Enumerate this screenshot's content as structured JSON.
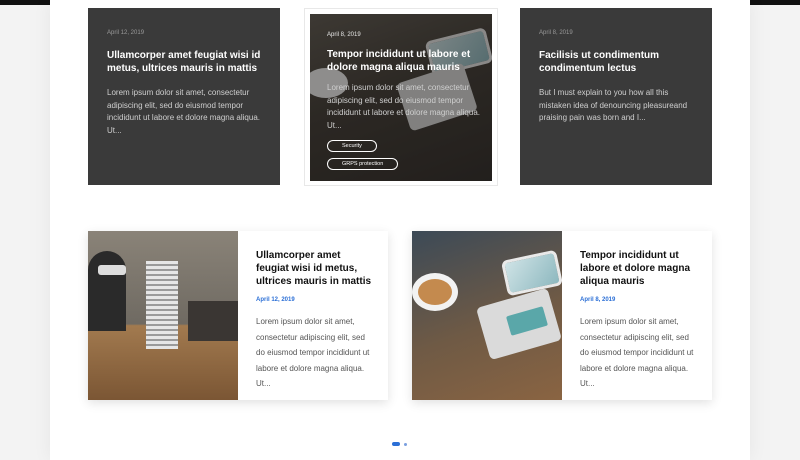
{
  "top_cards": [
    {
      "date": "April 12, 2019",
      "title": "Ullamcorper amet feugiat wisi id metus, ultrices mauris in mattis",
      "excerpt": "Lorem ipsum dolor sit amet, consectetur adipiscing elit, sed do eiusmod tempor incididunt ut labore et dolore magna aliqua. Ut..."
    },
    {
      "date": "April 8, 2019",
      "title": "Tempor incididunt ut labore et dolore magna aliqua mauris",
      "excerpt": "Lorem ipsum dolor sit amet, consectetur adipiscing elit, sed do eiusmod tempor incididunt ut labore et dolore magna aliqua. Ut...",
      "tags": [
        "Security",
        "GRPS protection"
      ]
    },
    {
      "date": "April 8, 2019",
      "title": "Facilisis ut condimentum condimentum lectus",
      "excerpt": "But I must explain to you how all this mistaken idea of denouncing pleasureand praising pain was born and I..."
    }
  ],
  "bottom_cards": [
    {
      "title": "Ullamcorper amet feugiat wisi id metus, ultrices mauris in mattis",
      "date": "April 12, 2019",
      "excerpt": "Lorem ipsum dolor sit amet, consectetur adipiscing elit, sed do eiusmod tempor incididunt ut labore et dolore magna aliqua. Ut..."
    },
    {
      "title": "Tempor incididunt ut labore et dolore magna aliqua mauris",
      "date": "April 8, 2019",
      "excerpt": "Lorem ipsum dolor sit amet, consectetur adipiscing elit, sed do eiusmod tempor incididunt ut labore et dolore magna aliqua. Ut..."
    }
  ],
  "colors": {
    "accent": "#2b6fd6",
    "dark_card": "#3a3a3a"
  },
  "pagination": {
    "count": 2,
    "active": 1
  }
}
